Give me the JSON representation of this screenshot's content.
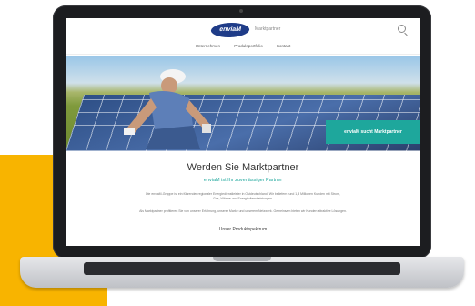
{
  "site": {
    "logo_text": "enviaM",
    "tagline": "Marktpartner",
    "nav": [
      "Unternehmen",
      "Produktportfolio",
      "Kontakt"
    ],
    "hero_cta": "enviaM sucht Marktpartner",
    "title": "Werden Sie Marktpartner",
    "subtitle": "enviaM ist Ihr zuverlässiger Partner",
    "paragraph_1": "Die enviaM-Gruppe ist ein führender regionaler Energiedienstleister in Ostdeutschland. Wir beliefern rund 1,3 Millionen Kunden mit Strom, Gas, Wärme und Energiedienstleistungen.",
    "paragraph_2": "Als Marktpartner profitieren Sie von unserer Erfahrung, unserer Marke und unserem Netzwerk. Gemeinsam bieten wir Kunden attraktive Lösungen.",
    "section_heading": "Unser Produktspektrum"
  },
  "colors": {
    "accent": "#f8b400",
    "teal": "#1ea79c",
    "logo_blue": "#1f3c88"
  }
}
